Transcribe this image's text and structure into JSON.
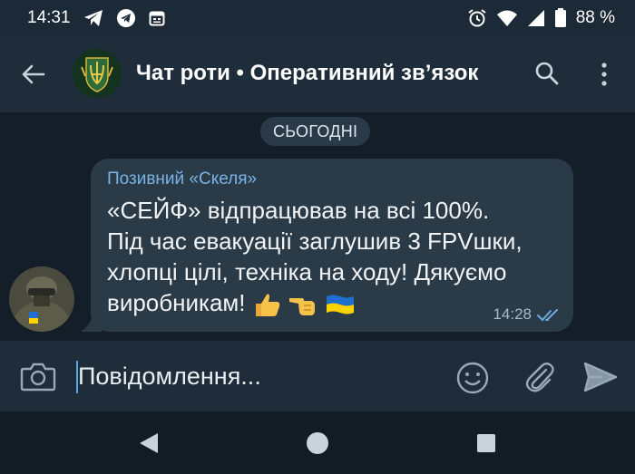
{
  "status_bar": {
    "time": "14:31",
    "battery": "88 %",
    "left_icons": [
      "telegram-plane-icon",
      "telegram-icon",
      "calendar-icon"
    ],
    "right_icons": [
      "alarm-icon",
      "wifi-icon",
      "signal-icon",
      "battery-icon"
    ]
  },
  "header": {
    "title": "Чат роти • Оперативний зв’язок",
    "icons": [
      "back-arrow-icon",
      "search-icon",
      "more-vert-icon"
    ]
  },
  "chat": {
    "date_label": "СЬОГОДНІ",
    "message": {
      "sender": "Позивний «Скеля»",
      "lines": [
        "«СЕЙФ» відпрацював на всі 100%.",
        "Під час евакуації заглушив 3 FPVшки,",
        "хлопці цілі, техніка на ходу! Дякуємо",
        "виробникам!"
      ],
      "emojis": [
        "thumbs-up",
        "pointing-hand",
        "ukraine-flag"
      ],
      "time": "14:28",
      "status": "read"
    }
  },
  "composer": {
    "placeholder": "Повідомлення...",
    "icons": [
      "camera-icon",
      "emoji-icon",
      "attach-icon",
      "send-icon"
    ]
  },
  "colors": {
    "accent": "#79b4e6",
    "bubble": "#2b3a47",
    "header": "#1f2d3a",
    "background": "#131e28"
  }
}
